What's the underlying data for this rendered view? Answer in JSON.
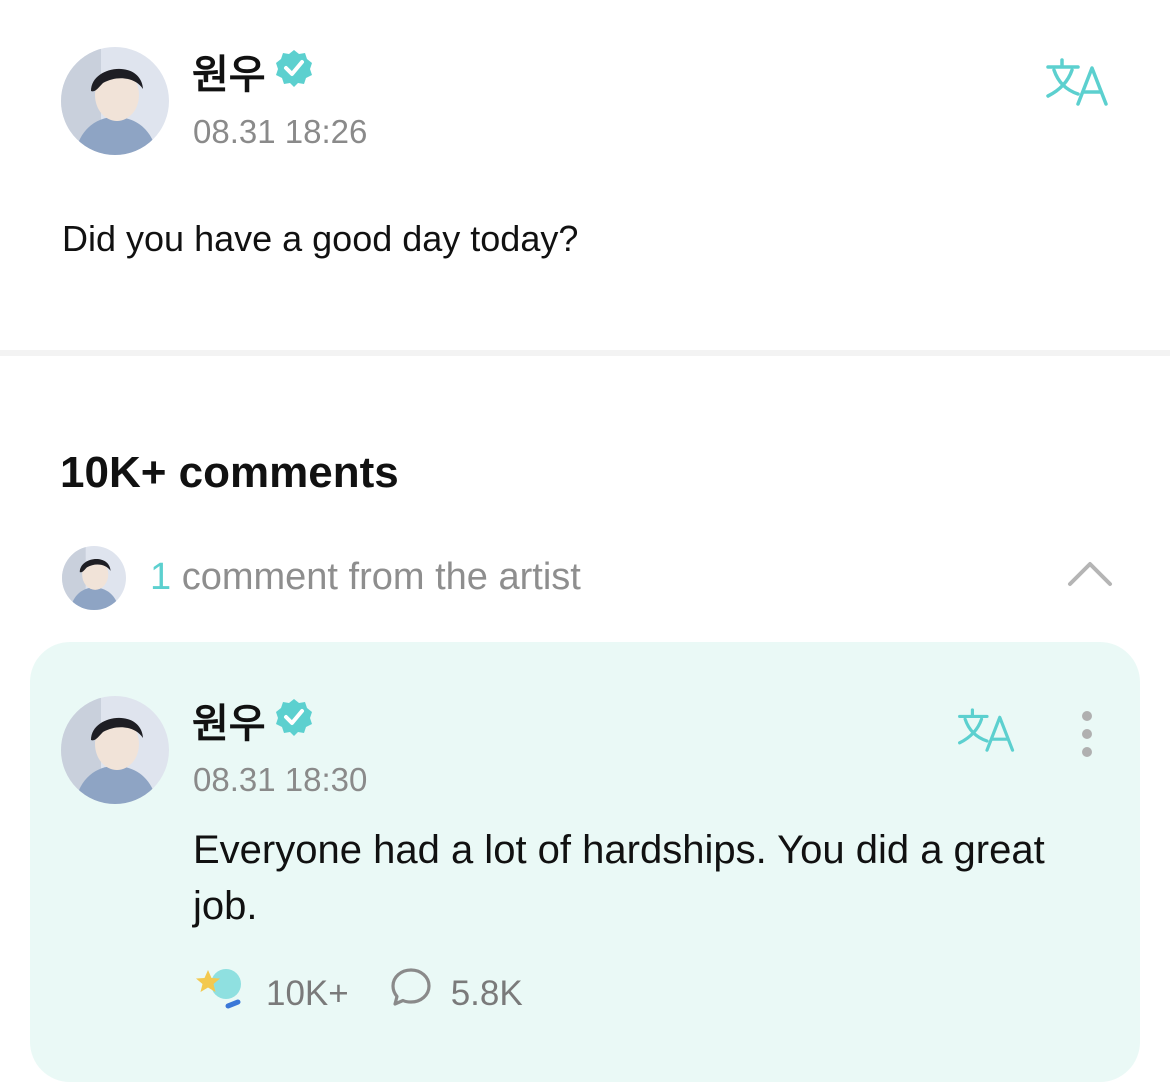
{
  "post": {
    "author": "원우",
    "timestamp": "08.31 18:26",
    "body": "Did you have a good day today?",
    "icons": {
      "verified": "verified-badge-icon",
      "translate": "translate-icon"
    }
  },
  "comments": {
    "heading": "10K+ comments",
    "artist_summary": {
      "count": "1",
      "label": "comment from the artist"
    }
  },
  "artist_comment": {
    "author": "원우",
    "timestamp": "08.31 18:30",
    "body": "Everyone had a lot of hardships. You did a great job.",
    "likes": "10K+",
    "replies": "5.8K"
  },
  "colors": {
    "accent": "#5cd0cf",
    "card_background": "#eaf9f6",
    "muted_text": "#8a8a8a"
  }
}
